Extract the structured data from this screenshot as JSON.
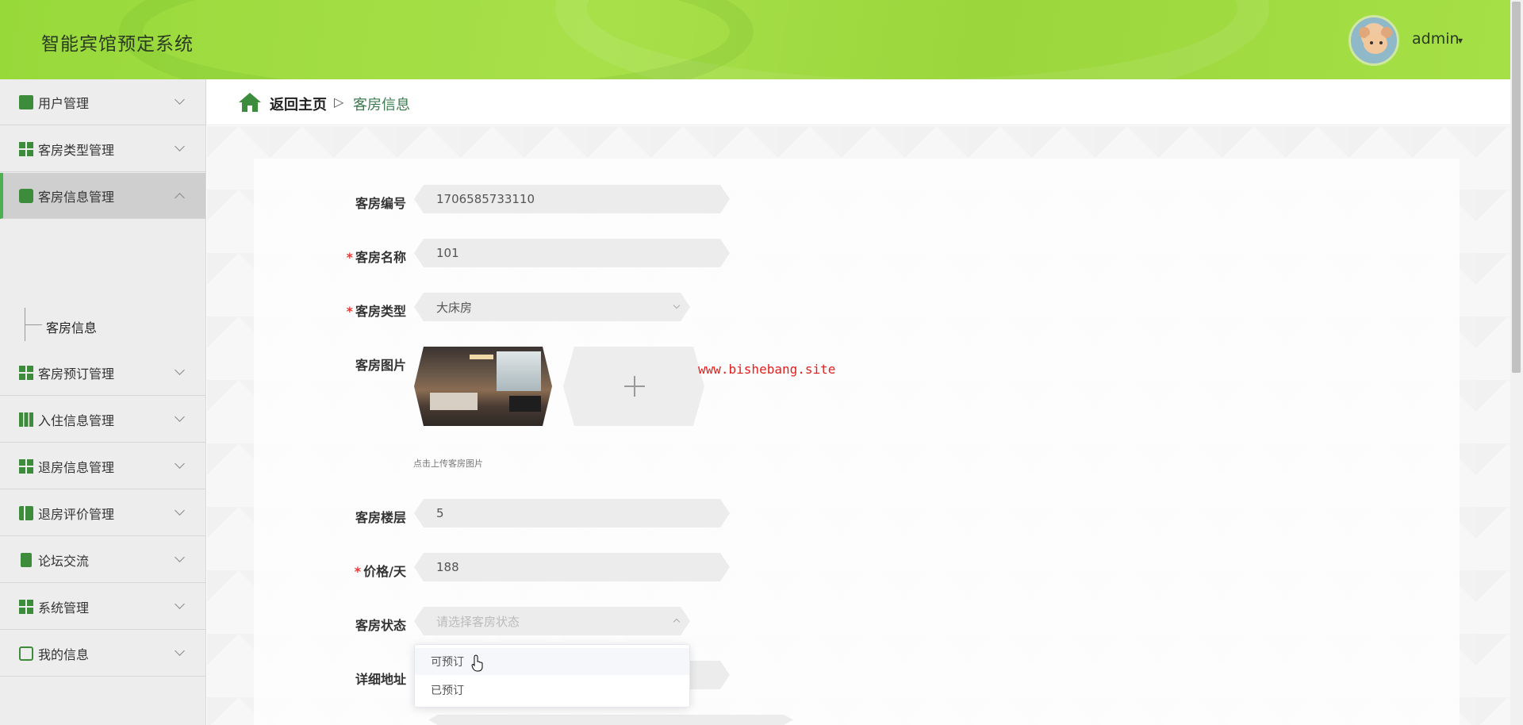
{
  "header": {
    "title": "智能宾馆预定系统",
    "user": "admin"
  },
  "sidebar": {
    "items": [
      {
        "label": "用户管理",
        "icon": "monitor-icon"
      },
      {
        "label": "客房类型管理",
        "icon": "grid-icon"
      },
      {
        "label": "客房信息管理",
        "icon": "chat-icon",
        "active": true
      },
      {
        "label": "客房预订管理",
        "icon": "grid-icon"
      },
      {
        "label": "入住信息管理",
        "icon": "grid9-icon"
      },
      {
        "label": "退房信息管理",
        "icon": "grid-icon"
      },
      {
        "label": "退房评价管理",
        "icon": "book-icon"
      },
      {
        "label": "论坛交流",
        "icon": "clipboard-icon"
      },
      {
        "label": "系统管理",
        "icon": "grid-icon"
      },
      {
        "label": "我的信息",
        "icon": "card-icon"
      }
    ],
    "submenu": {
      "label": "客房信息"
    }
  },
  "breadcrumb": {
    "home": "返回主页",
    "separator": "▷",
    "current": "客房信息"
  },
  "form": {
    "room_number": {
      "label": "客房编号",
      "value": "1706585733110"
    },
    "room_name": {
      "label": "客房名称",
      "value": "101",
      "required": "*"
    },
    "room_type": {
      "label": "客房类型",
      "value": "大床房",
      "required": "*"
    },
    "room_image": {
      "label": "客房图片",
      "hint": "点击上传客房图片"
    },
    "floor": {
      "label": "客房楼层",
      "value": "5"
    },
    "price": {
      "label": "价格/天",
      "value": "188",
      "required": "*"
    },
    "status": {
      "label": "客房状态",
      "placeholder": "请选择客房状态"
    },
    "address": {
      "label": "详细地址"
    }
  },
  "dropdown": {
    "options": [
      "可预订",
      "已预订"
    ]
  },
  "watermark": "www.bishebang.site",
  "colors": {
    "accent": "#3c8c3c",
    "header": "#a5e046",
    "required": "#e53935"
  }
}
